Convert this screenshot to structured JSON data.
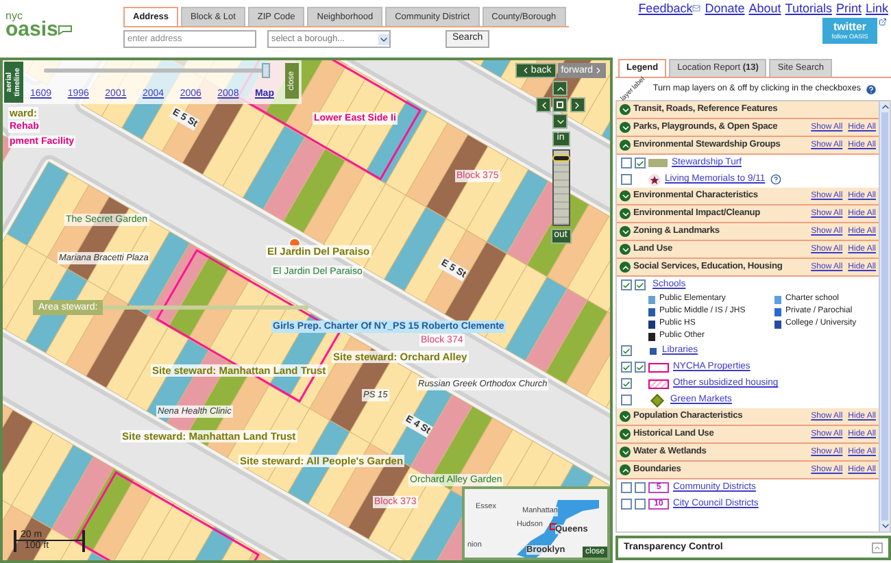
{
  "header": {
    "logo_small": "nyc",
    "logo_big": "oasis",
    "search_tabs": [
      {
        "label": "Address",
        "selected": true
      },
      {
        "label": "Block & Lot",
        "selected": false
      },
      {
        "label": "ZIP Code",
        "selected": false
      },
      {
        "label": "Neighborhood",
        "selected": false
      },
      {
        "label": "Community District",
        "selected": false
      },
      {
        "label": "County/Borough",
        "selected": false
      }
    ],
    "address_field": {
      "placeholder": "enter address"
    },
    "borough_select": {
      "placeholder": "select a borough..."
    },
    "search_button": "Search",
    "links": [
      "Feedback",
      "Donate",
      "About",
      "Tutorials",
      "Print",
      "Link"
    ],
    "twitter": {
      "title": "twitter",
      "subtitle": "follow OASIS"
    }
  },
  "map": {
    "timeline": {
      "label": "aerial timeline",
      "close": "close",
      "years": [
        {
          "label": "1609",
          "selected": false
        },
        {
          "label": "1996",
          "selected": false
        },
        {
          "label": "2001",
          "selected": false
        },
        {
          "label": "2004",
          "selected": false
        },
        {
          "label": "2006",
          "selected": false
        },
        {
          "label": "2008",
          "selected": false
        },
        {
          "label": "Map",
          "selected": true
        }
      ]
    },
    "nav": {
      "back": "back",
      "forward": "forward",
      "zoom_in": "in",
      "zoom_out": "out",
      "zoom": {
        "level": 0.95
      }
    },
    "labels": [
      {
        "text": "ward:",
        "kind": "steward"
      },
      {
        "text": "Rehab",
        "kind": "pink"
      },
      {
        "text": "pment Facility",
        "kind": "pink"
      },
      {
        "text": "E 5 St",
        "kind": "street"
      },
      {
        "text": "Lower East Side Ii",
        "kind": "pink"
      },
      {
        "text": "The Secret Garden",
        "kind": "garden"
      },
      {
        "text": "Block 375",
        "kind": "block"
      },
      {
        "text": "El Jardin Del Paraiso",
        "kind": "steward"
      },
      {
        "text": "El Jardin Del Paraiso",
        "kind": "garden"
      },
      {
        "text": "Mariana Bracetti Plaza",
        "kind": "place"
      },
      {
        "text": "E 5 St",
        "kind": "street"
      },
      {
        "text": "Area steward:",
        "kind": "callout"
      },
      {
        "text": "Girls Prep. Charter Of NY_PS 15 Roberto Clemente",
        "kind": "school"
      },
      {
        "text": "Block 374",
        "kind": "block"
      },
      {
        "text": "PS 15",
        "kind": "place"
      },
      {
        "text": "Site steward: Manhattan Land Trust",
        "kind": "steward"
      },
      {
        "text": "Site steward: Orchard Alley",
        "kind": "steward"
      },
      {
        "text": "Russian Greek Orthodox Church",
        "kind": "place"
      },
      {
        "text": "Nena Health Clinic",
        "kind": "place"
      },
      {
        "text": "E 4 St",
        "kind": "street"
      },
      {
        "text": "Site steward: Manhattan Land Trust",
        "kind": "steward"
      },
      {
        "text": "Site steward: All People's Garden",
        "kind": "steward"
      },
      {
        "text": "Orchard Alley Garden",
        "kind": "garden"
      },
      {
        "text": "Block 373",
        "kind": "block"
      }
    ],
    "scale": {
      "metric": "20 m",
      "imperial": "100 ft"
    },
    "overview": {
      "places": [
        "Essex",
        "Manhattan",
        "Hudson",
        "Queens",
        "nion",
        "Brooklyn"
      ],
      "close": "close"
    }
  },
  "legend": {
    "tabs": [
      {
        "label": "Legend",
        "selected": true
      },
      {
        "label": "Location Report **(13)**",
        "selected": false
      },
      {
        "label": "Site Search",
        "selected": false
      }
    ],
    "column_labels": [
      "layer",
      "label"
    ],
    "instructions": "Turn map layers on & off by clicking in the checkboxes",
    "sections": [
      {
        "title": "Transit, Roads, Reference Features",
        "expanded": false
      },
      {
        "title": "Parks, Playgrounds, & Open Space",
        "expanded": false,
        "show_all": "Show All",
        "hide_all": "Hide All"
      },
      {
        "title": "Environmental Stewardship Groups",
        "expanded": true,
        "show_all": "Show All",
        "hide_all": "Hide All",
        "items": [
          {
            "label": "Stewardship Turf",
            "kind": "swatch",
            "checkboxes": [
              {
                "checked": false
              },
              {
                "checked": true
              }
            ]
          },
          {
            "label": "Living Memorials to 9/11",
            "kind": "star",
            "checkboxes": [
              {
                "checked": false
              }
            ]
          }
        ]
      },
      {
        "title": "Environmental Characteristics",
        "expanded": false,
        "show_all": "Show All",
        "hide_all": "Hide All"
      },
      {
        "title": "Environmental Impact/Cleanup",
        "expanded": false,
        "show_all": "Show All",
        "hide_all": "Hide All"
      },
      {
        "title": "Zoning & Landmarks",
        "expanded": false,
        "show_all": "Show All",
        "hide_all": "Hide All"
      },
      {
        "title": "Land Use",
        "expanded": false,
        "show_all": "Show All",
        "hide_all": "Hide All"
      },
      {
        "title": "Social Services, Education, Housing",
        "expanded": true,
        "show_all": "Show All",
        "hide_all": "Hide All",
        "items": [
          {
            "label": "Schools",
            "kind": "schools",
            "checkboxes": [
              {
                "checked": true
              },
              {
                "checked": true
              }
            ],
            "key": [
              {
                "label": "Public Elementary",
                "kind": "elementary"
              },
              {
                "label": "Public Middle / IS / JHS",
                "kind": "middle"
              },
              {
                "label": "Public HS",
                "kind": "hs"
              },
              {
                "label": "Public Other",
                "kind": "other"
              },
              {
                "label": "Charter school",
                "kind": "charter"
              },
              {
                "label": "Private / Parochial",
                "kind": "private"
              },
              {
                "label": "College / University",
                "kind": "college"
              }
            ]
          },
          {
            "label": "Libraries",
            "kind": "library",
            "checkboxes": [
              {
                "checked": true
              }
            ]
          },
          {
            "label": "NYCHA Properties",
            "kind": "outline",
            "checkboxes": [
              {
                "checked": true
              },
              {
                "checked": true
              }
            ]
          },
          {
            "label": "Other subsidized housing",
            "kind": "hatch",
            "checkboxes": [
              {
                "checked": true
              }
            ]
          },
          {
            "label": "Green Markets",
            "kind": "diamond",
            "checkboxes": [
              {
                "checked": false
              }
            ]
          }
        ]
      },
      {
        "title": "Population Characteristics",
        "expanded": false,
        "show_all": "Show All",
        "hide_all": "Hide All"
      },
      {
        "title": "Historical Land Use",
        "expanded": false,
        "show_all": "Show All",
        "hide_all": "Hide All"
      },
      {
        "title": "Water & Wetlands",
        "expanded": false,
        "show_all": "Show All",
        "hide_all": "Hide All"
      },
      {
        "title": "Boundaries",
        "expanded": true,
        "show_all": "Show All",
        "hide_all": "Hide All",
        "items": [
          {
            "label": "Community Districts",
            "kind": "number",
            "badge": "5",
            "checkboxes": [
              {
                "checked": false
              },
              {
                "checked": false
              }
            ]
          },
          {
            "label": "City Council Districts",
            "kind": "number",
            "badge": "10",
            "checkboxes": [
              {
                "checked": false
              },
              {
                "checked": false
              }
            ]
          }
        ]
      }
    ],
    "transparency": "Transparency Control"
  }
}
